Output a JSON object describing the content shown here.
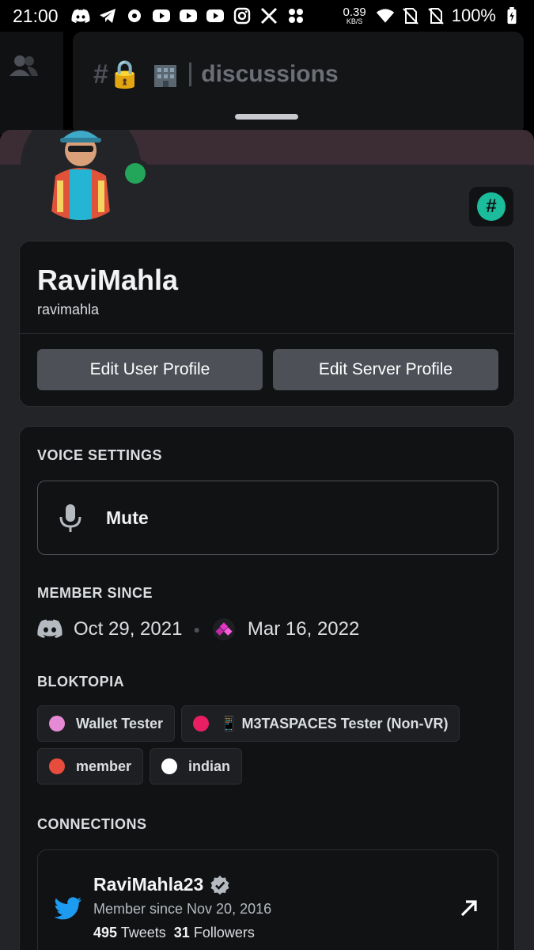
{
  "status_bar": {
    "time": "21:00",
    "net_speed_value": "0.39",
    "net_speed_unit": "KB/S",
    "battery": "100%"
  },
  "channel": {
    "name": "discussions"
  },
  "profile": {
    "display_name": "RaviMahla",
    "username": "ravimahla",
    "edit_user_label": "Edit User Profile",
    "edit_server_label": "Edit Server Profile",
    "status_color": "#23a55a"
  },
  "voice": {
    "title": "VOICE SETTINGS",
    "mute_label": "Mute"
  },
  "member_since": {
    "title": "MEMBER SINCE",
    "discord_date": "Oct 29, 2021",
    "server_date": "Mar 16, 2022"
  },
  "server_roles": {
    "title": "BLOKTOPIA",
    "roles": [
      {
        "label": "Wallet Tester",
        "color": "#e68ad6"
      },
      {
        "label": "📱 M3TASPACES Tester (Non-VR)",
        "color": "#e91e63"
      },
      {
        "label": "member",
        "color": "#e74c3c"
      },
      {
        "label": "indian",
        "color": "#ffffff"
      }
    ]
  },
  "connections": {
    "title": "CONNECTIONS",
    "items": [
      {
        "platform_icon": "twitter-icon",
        "account": "RaviMahla23",
        "since": "Member since Nov 20, 2016",
        "tweets_count": "495",
        "tweets_label": "Tweets",
        "followers_count": "31",
        "followers_label": "Followers"
      }
    ]
  }
}
